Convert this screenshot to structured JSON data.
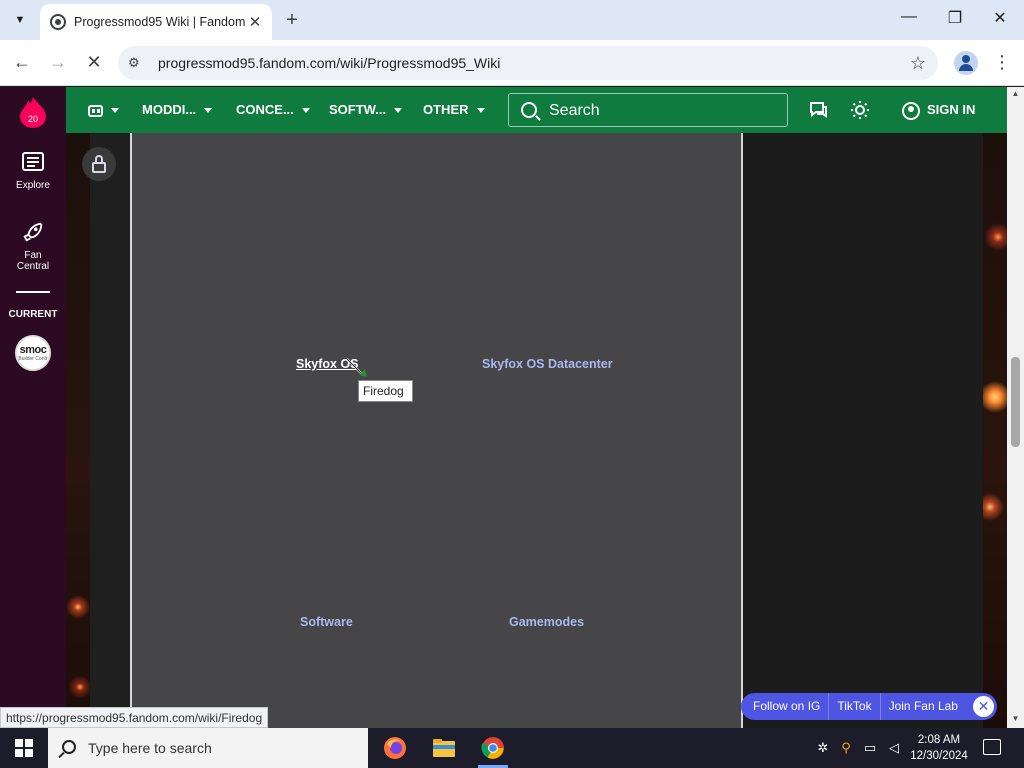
{
  "browser": {
    "tab_title": "Progressmod95 Wiki | Fandom",
    "tab_close": "✕",
    "new_tab": "+",
    "url": "progressmod95.fandom.com/wiki/Progressmod95_Wiki",
    "window_minimize": "—",
    "window_maximize": "❐",
    "window_close": "✕"
  },
  "rail": {
    "badge": "20",
    "explore": "Explore",
    "fan_central_line1": "Fan",
    "fan_central_line2": "Central",
    "current": "CURRENT",
    "avatar_text": "smoc",
    "avatar_sub": "Builder Contr"
  },
  "navbar": {
    "items": [
      "MODDI...",
      "CONCE...",
      "SOFTW...",
      "OTHER"
    ],
    "search_placeholder": "Search",
    "sign_in": "SIGN IN"
  },
  "content": {
    "links": {
      "skyfox_os": "Skyfox OS",
      "skyfox_datacenter": "Skyfox OS Datacenter",
      "software": "Software",
      "gamemodes": "Gamemodes"
    },
    "tooltip": "Firedog"
  },
  "social": {
    "instagram": "Follow on IG",
    "tiktok": "TikTok",
    "fanlab": "Join Fan Lab",
    "close": "✕"
  },
  "status_url": "https://progressmod95.fandom.com/wiki/Firedog",
  "taskbar": {
    "search_placeholder": "Type here to search",
    "time": "2:08 AM",
    "date": "12/30/2024"
  },
  "colors": {
    "fandom_green": "#0f7b3e",
    "rail_purple": "#2c0a24",
    "content_gray": "#464547",
    "link_blue": "#a8b8f0",
    "social_blue": "#4f55e3"
  }
}
